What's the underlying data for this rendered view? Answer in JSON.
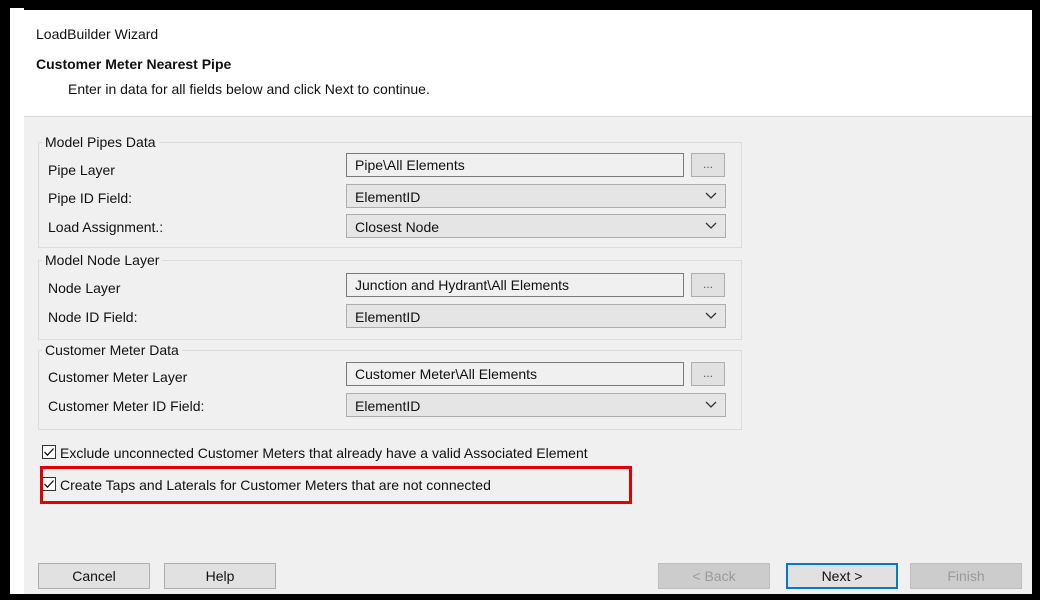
{
  "window": {
    "title": "LoadBuilder Wizard",
    "subtitle": "Customer Meter Nearest Pipe",
    "description": "Enter in data for all fields below and click Next to continue."
  },
  "model_pipes": {
    "legend": "Model Pipes Data",
    "pipe_layer_label": "Pipe Layer",
    "pipe_layer_value": "Pipe\\All Elements",
    "pipe_id_label": "Pipe ID Field:",
    "pipe_id_value": "ElementID",
    "load_assignment_label": "Load Assignment.:",
    "load_assignment_value": "Closest Node"
  },
  "model_node": {
    "legend": "Model Node Layer",
    "node_layer_label": "Node Layer",
    "node_layer_value": "Junction and Hydrant\\All Elements",
    "node_id_label": "Node ID Field:",
    "node_id_value": "ElementID"
  },
  "customer_meter": {
    "legend": "Customer Meter Data",
    "layer_label": "Customer Meter Layer",
    "layer_value": "Customer Meter\\All Elements",
    "id_label": "Customer Meter ID Field:",
    "id_value": "ElementID"
  },
  "browse_label": "...",
  "options": {
    "exclude_label": "Exclude unconnected Customer Meters that already have a valid Associated Element",
    "exclude_checked": true,
    "create_taps_label": "Create Taps and Laterals for Customer Meters that are not connected",
    "create_taps_checked": true
  },
  "highlight_color": "#e00000",
  "footer": {
    "cancel": "Cancel",
    "help": "Help",
    "back": "< Back",
    "next": "Next >",
    "finish": "Finish"
  }
}
